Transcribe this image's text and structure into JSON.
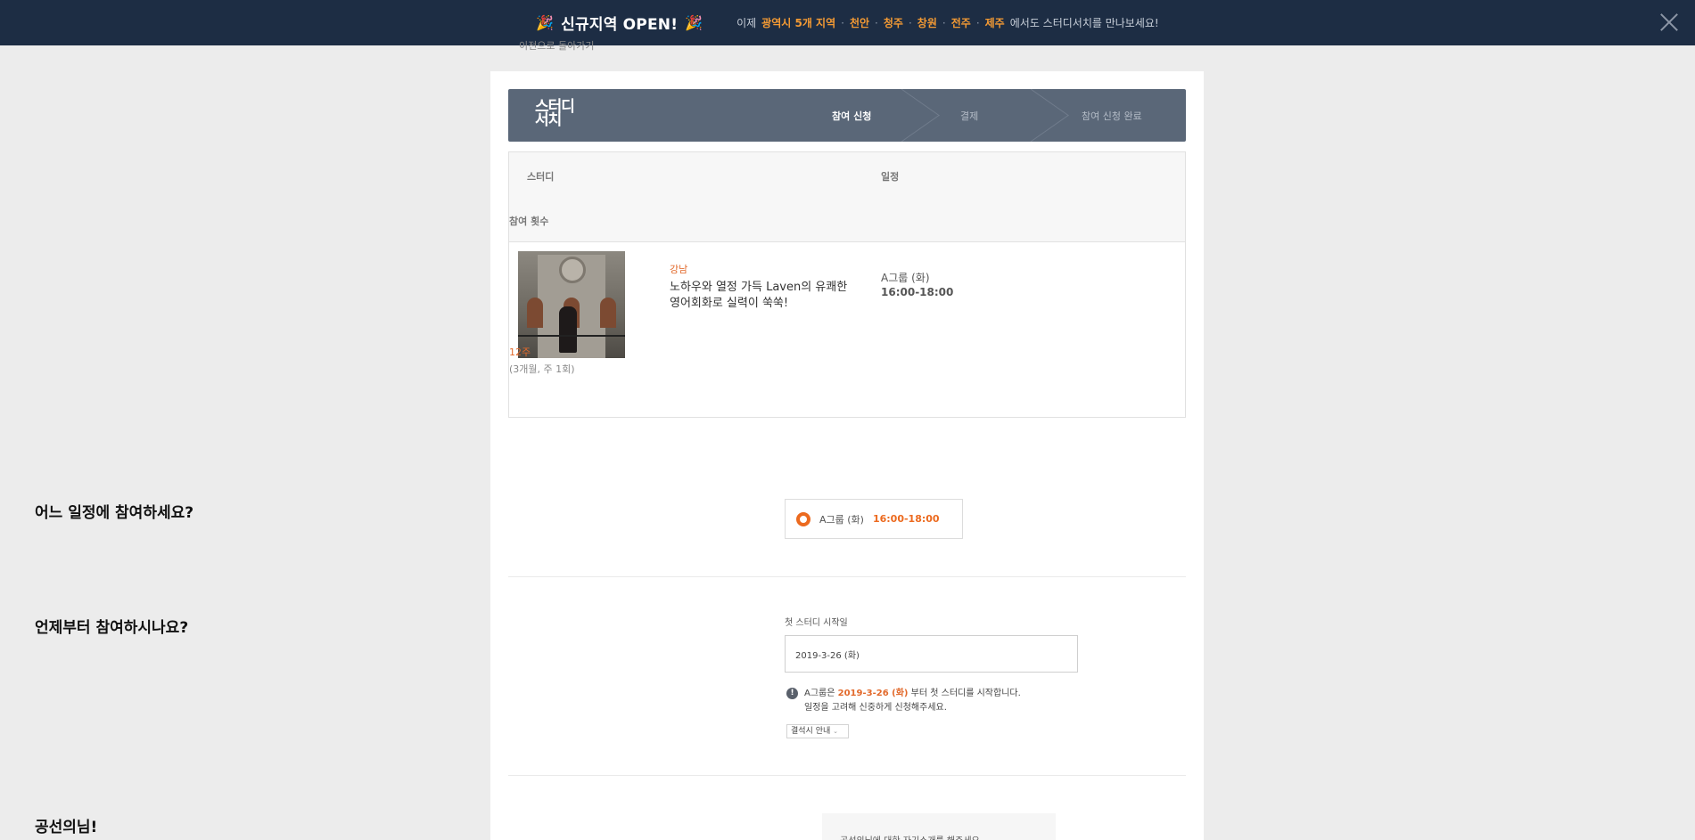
{
  "banner": {
    "party_left": "🎉",
    "title": "신규지역 OPEN!",
    "party_right": "🎉",
    "prefix": "이제",
    "regions": [
      "광역시 5개 지역",
      "천안",
      "청주",
      "창원",
      "전주",
      "제주"
    ],
    "suffix": "에서도 스터디서치를 만나보세요!"
  },
  "back_link": "이전으로 돌아가기",
  "stepbar": {
    "logo_line1": "스터디",
    "logo_line2": "서치",
    "steps": [
      {
        "label": "참여 신청",
        "active": true
      },
      {
        "label": "결제",
        "active": false
      },
      {
        "label": "참여 신청 완료",
        "active": false
      }
    ]
  },
  "table": {
    "headers": {
      "study": "스터디",
      "schedule": "일정",
      "count": "참여 횟수"
    },
    "row": {
      "region": "강남",
      "title": "노하우와 열정 가득 Laven의 유쾌한 영어회화로 실력이 쑥쑥!",
      "group": "A그룹 (화)",
      "time": "16:00-18:00",
      "weeks": "12주",
      "weeks_detail": "(3개월, 주 1회)"
    }
  },
  "schedule_section": {
    "question": "어느 일정에 참여하세요?",
    "option_group": "A그룹 (화)",
    "option_time": "16:00-18:00"
  },
  "start_section": {
    "question": "언제부터 참여하시나요?",
    "field_label": "첫 스터디 시작일",
    "date_value": "2019-3-26 (화)",
    "notice_prefix": "A그룹은",
    "notice_date": "2019-3-26 (화)",
    "notice_suffix": "부터 첫 스터디를 시작합니다.",
    "notice_line2": "일정을 고려해 신중하게 신청해주세요.",
    "absence_label": "결석시 안내"
  },
  "intro_section": {
    "title": "공선의님!",
    "box_text": "공선의님에 대한 자기소개를 해주세요."
  },
  "colors": {
    "banner_bg": "#1d2d44",
    "accent": "#ec6a1f",
    "stepbar_bg": "#5a6778"
  }
}
